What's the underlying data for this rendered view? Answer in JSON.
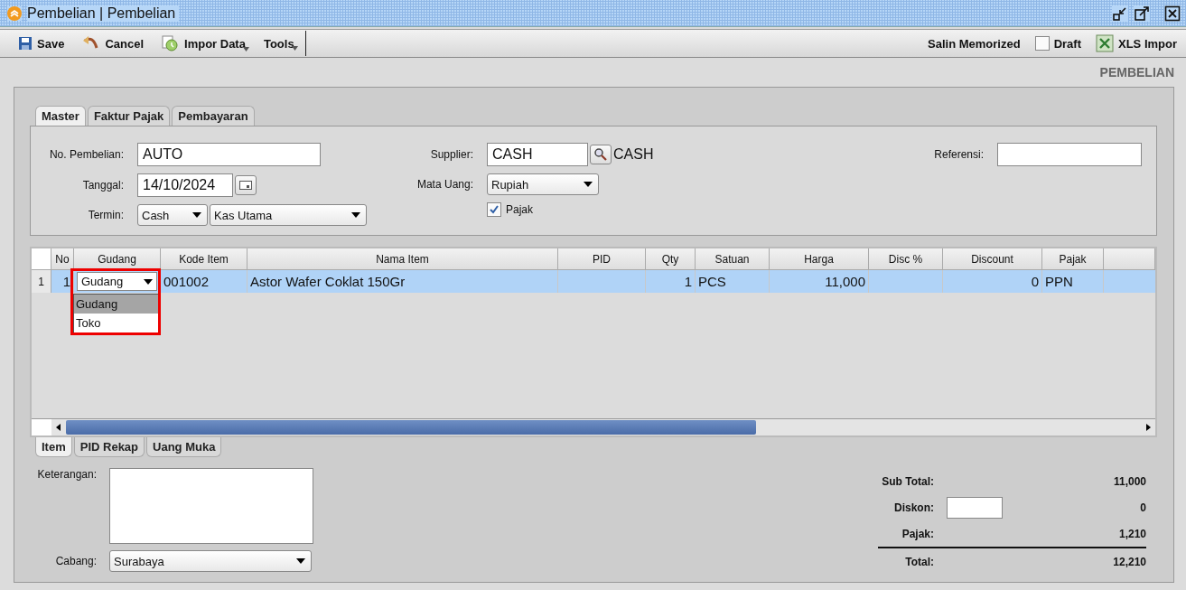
{
  "window": {
    "title": "Pembelian | Pembelian"
  },
  "toolbar": {
    "left": [
      {
        "label": "Save",
        "kind": "save"
      },
      {
        "label": "Cancel",
        "kind": "cancel"
      },
      {
        "label": "Impor Data",
        "kind": "import"
      },
      {
        "label": "Tools",
        "kind": "menu"
      }
    ],
    "memorized": "Salin Memorized",
    "draft": {
      "label": "Draft",
      "checked": false
    },
    "xls": "XLS Impor"
  },
  "heading": "PEMBELIAN",
  "tabs": [
    {
      "label": "Master",
      "selected": true
    },
    {
      "label": "Faktur Pajak",
      "selected": false
    },
    {
      "label": "Pembayaran",
      "selected": false
    }
  ],
  "form": {
    "no_pembelian": {
      "label": "No. Pembelian:",
      "value": "AUTO"
    },
    "tanggal": {
      "label": "Tanggal:",
      "value": "14/10/2024"
    },
    "termin": {
      "label": "Termin:",
      "value": "Cash",
      "account": "Kas Utama"
    },
    "supplier": {
      "label": "Supplier:",
      "value": "CASH",
      "name": "CASH"
    },
    "mata_uang": {
      "label": "Mata Uang:",
      "value": "Rupiah"
    },
    "pajak": {
      "label": "Pajak",
      "checked": true
    },
    "referensi": {
      "label": "Referensi:"
    }
  },
  "table": {
    "columns": [
      {
        "label": "No",
        "kind": "number"
      },
      {
        "label": "Gudang",
        "kind": "combo"
      },
      {
        "label": "Kode Item",
        "kind": "text"
      },
      {
        "label": "Nama Item",
        "kind": "text"
      },
      {
        "label": "PID",
        "kind": "text"
      },
      {
        "label": "Qty",
        "kind": "number"
      },
      {
        "label": "Satuan",
        "kind": "text"
      },
      {
        "label": "Harga",
        "kind": "number"
      },
      {
        "label": "Disc %",
        "kind": "number"
      },
      {
        "label": "Discount",
        "kind": "number"
      },
      {
        "label": "Pajak",
        "kind": "text"
      }
    ],
    "rows": [
      {
        "row_header": "1",
        "selected": true,
        "cells": [
          "1",
          "Gudang",
          "001002",
          "Astor Wafer Coklat 150Gr",
          "",
          "1",
          "PCS",
          "11,000",
          "",
          "0",
          "PPN"
        ]
      }
    ]
  },
  "dropdown": {
    "options": [
      {
        "label": "Gudang",
        "selected": true
      },
      {
        "label": "Toko",
        "selected": false
      }
    ]
  },
  "bottom_tabs": [
    {
      "label": "Item",
      "selected": true
    },
    {
      "label": "PID Rekap",
      "selected": false
    },
    {
      "label": "Uang Muka",
      "selected": false
    }
  ],
  "keterangan": {
    "label": "Keterangan:"
  },
  "cabang": {
    "label": "Cabang:",
    "value": "Surabaya"
  },
  "totals": [
    {
      "label": "Sub Total:",
      "value": "11,000",
      "kind": "amount"
    },
    {
      "label": "Diskon:",
      "value": "0",
      "kind": "discount"
    },
    {
      "label": "Pajak:",
      "value": "1,210",
      "kind": "amount"
    },
    {
      "label": "Total:",
      "value": "12,210",
      "kind": "total"
    }
  ]
}
